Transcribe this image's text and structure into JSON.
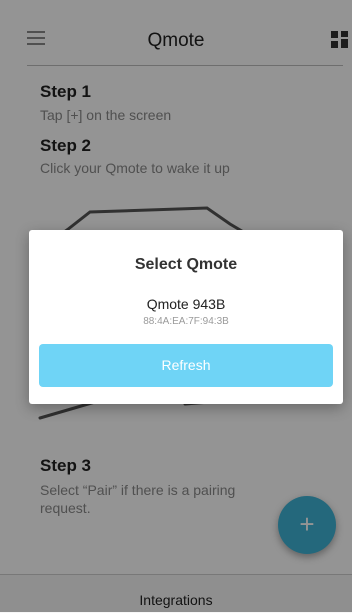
{
  "header": {
    "title": "Qmote"
  },
  "steps": [
    {
      "title": "Step 1",
      "description": "Tap [+] on the screen"
    },
    {
      "title": "Step 2",
      "description": "Click your Qmote to wake it up"
    },
    {
      "title": "Step 3",
      "description_line1": "Select “Pair” if there is a pairing",
      "description_line2": "request."
    }
  ],
  "fab": {
    "label": "+"
  },
  "footer": {
    "label": "Integrations"
  },
  "dialog": {
    "title": "Select Qmote",
    "devices": [
      {
        "name": "Qmote 943B",
        "address": "88:4A:EA:7F:94:3B"
      }
    ],
    "refresh_label": "Refresh"
  },
  "colors": {
    "accent": "#3fb3d6",
    "refresh_button": "#6fd4f6",
    "overlay": "rgba(0,0,0,0.42)"
  },
  "icons": {
    "menu": "hamburger-menu-icon",
    "grid": "grid-icon",
    "add": "plus-icon"
  }
}
